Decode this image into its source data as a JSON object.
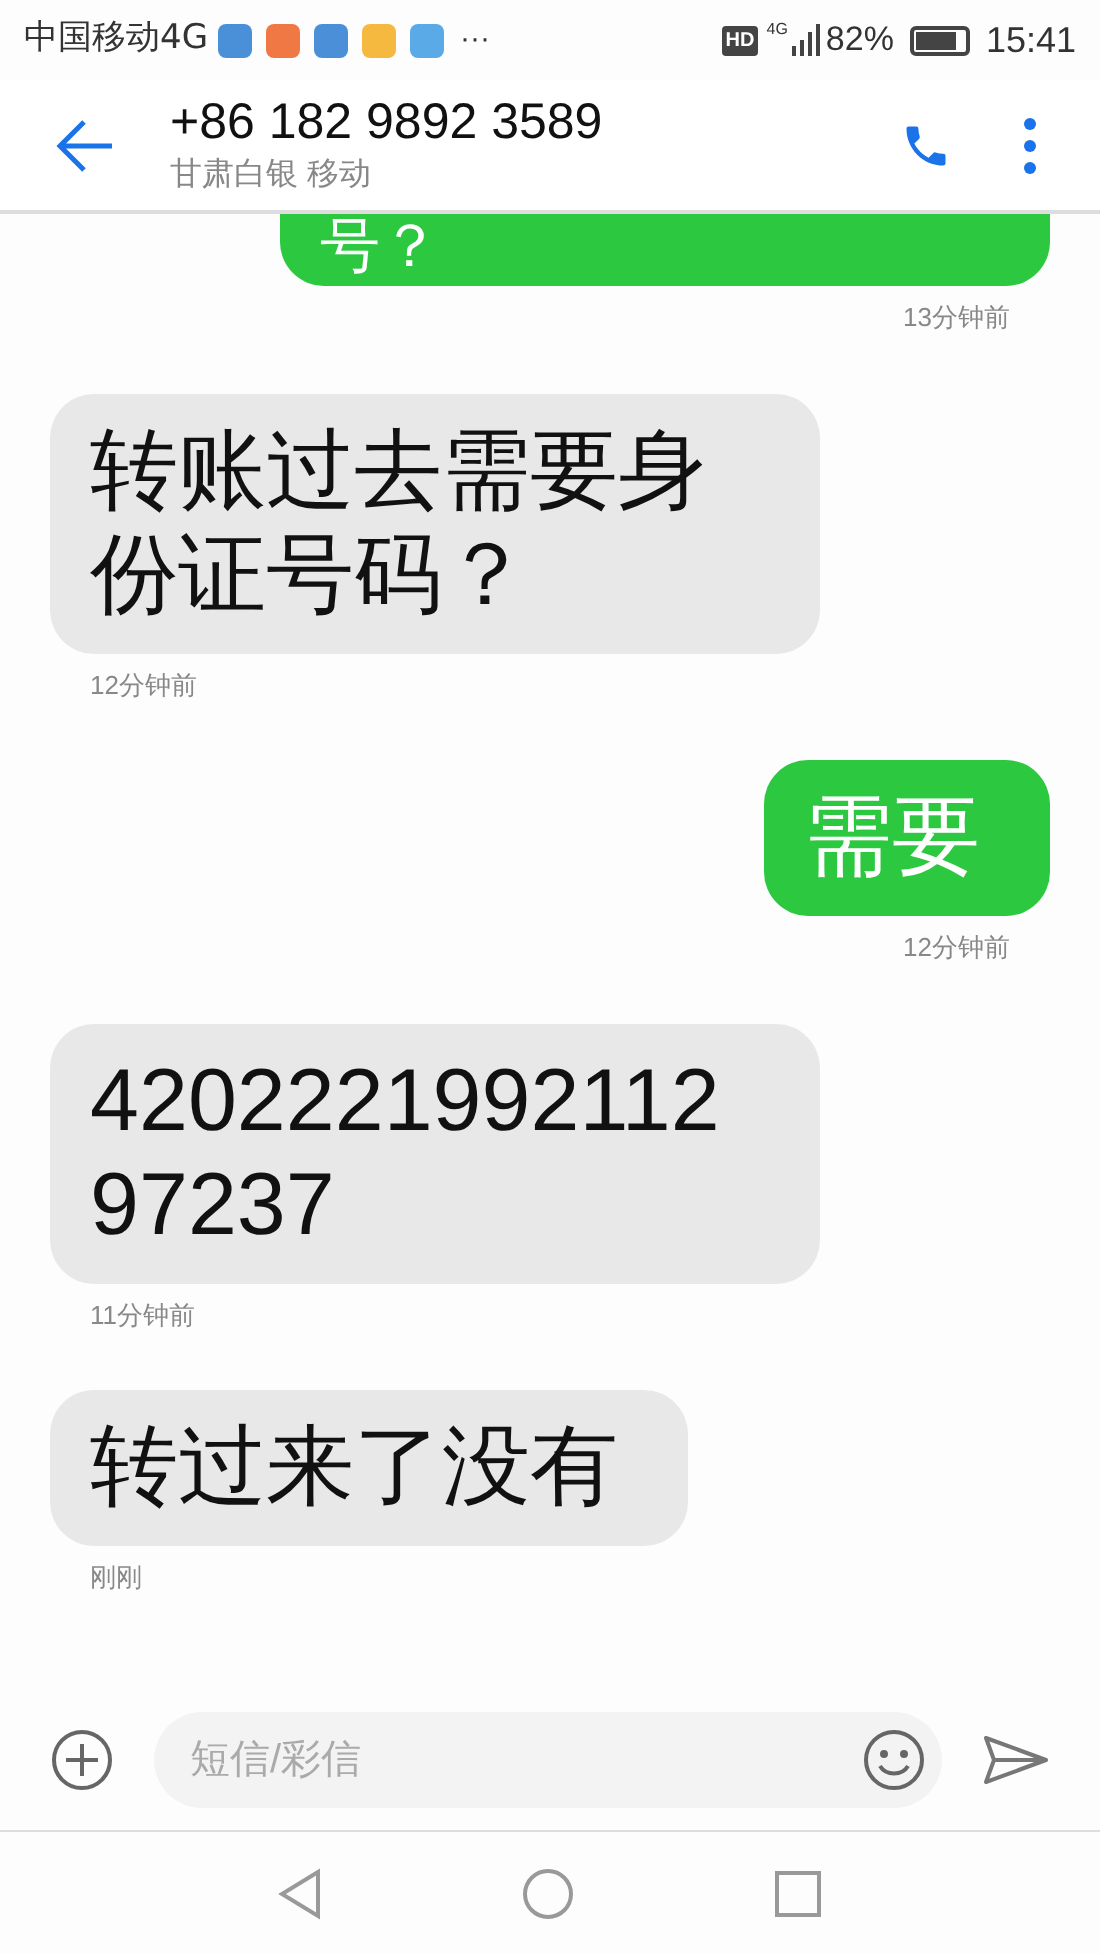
{
  "status_bar": {
    "carrier": "中国移动4G",
    "notification_apps": [
      {
        "color": "#4a90d9"
      },
      {
        "color": "#f07844"
      },
      {
        "color": "#4a8fd8"
      },
      {
        "color": "#f5b940"
      },
      {
        "color": "#5aaae8"
      }
    ],
    "more": "···",
    "hd": "HD",
    "network": "4G",
    "battery": "82%",
    "level": 0.82,
    "time": "15:41"
  },
  "header": {
    "title": "+86 182 9892 3589",
    "subtitle": "甘肃白银 移动"
  },
  "messages": [
    {
      "kind": "outgoing",
      "text": "号？",
      "time": "13分钟前"
    },
    {
      "kind": "incoming",
      "text": "转账过去需要身份证号码？",
      "time": "12分钟前"
    },
    {
      "kind": "outgoing",
      "text": "需要",
      "time": "12分钟前"
    },
    {
      "kind": "incoming",
      "text": "420222199211297237",
      "time": "11分钟前"
    },
    {
      "kind": "incoming",
      "text": "转过来了没有",
      "time": "刚刚"
    }
  ],
  "composer": {
    "placeholder": "短信/彩信"
  }
}
